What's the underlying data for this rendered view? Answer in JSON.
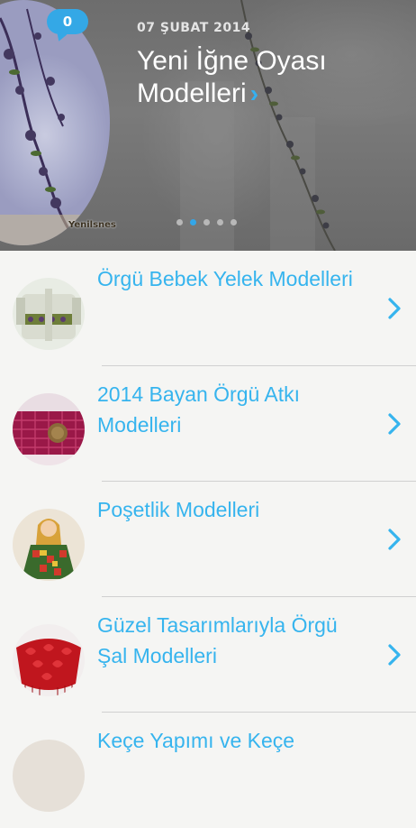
{
  "hero": {
    "comment_count": "0",
    "date": "07 ŞUBAT 2014",
    "title": "Yeni İğne Oyası Modelleri",
    "thumb_caption": "Yenilsnes",
    "chevron_glyph": "›",
    "slides_total": 5,
    "slide_active": 2,
    "accent_color": "#34a8e6"
  },
  "list": {
    "items": [
      {
        "title": "Örgü Bebek Yelek Modelleri",
        "icon": "chevron-right-icon"
      },
      {
        "title": "2014 Bayan Örgü Atkı Modelleri",
        "icon": "chevron-right-icon"
      },
      {
        "title": "Poşetlik Modelleri",
        "icon": "chevron-right-icon"
      },
      {
        "title": "Güzel Tasarımlarıyla Örgü Şal Modelleri",
        "icon": "chevron-right-icon"
      },
      {
        "title": "Keçe Yapımı ve Keçe",
        "icon": "chevron-right-icon"
      }
    ],
    "title_color": "#36b4ee"
  }
}
